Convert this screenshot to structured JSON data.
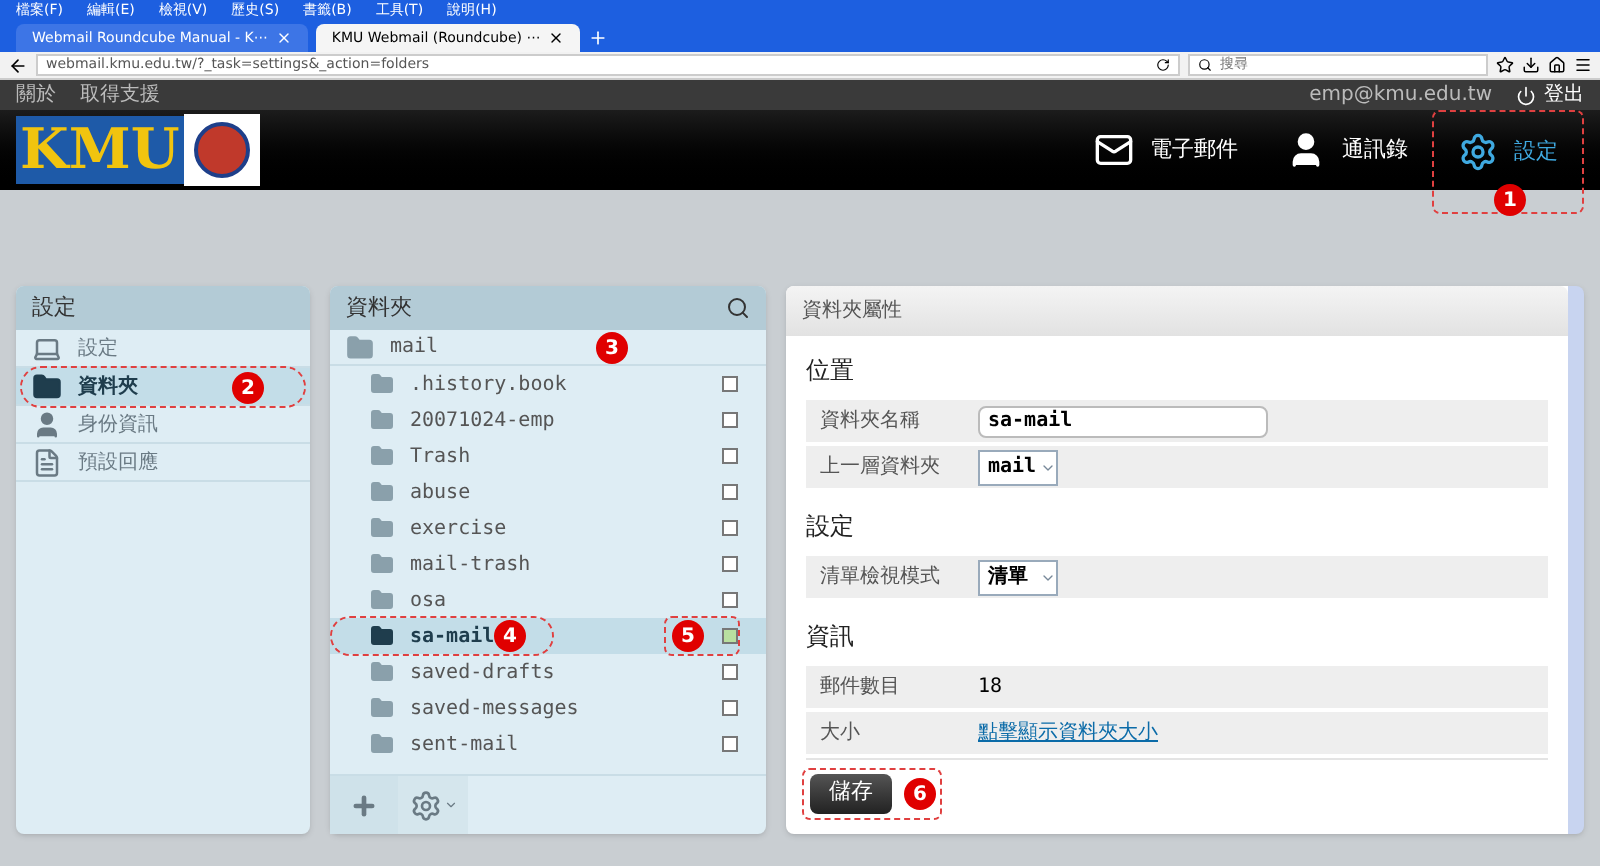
{
  "browser": {
    "menu": [
      "檔案(F)",
      "編輯(E)",
      "檢視(V)",
      "歷史(S)",
      "書籤(B)",
      "工具(T)",
      "說明(H)"
    ],
    "tabs": [
      {
        "label": "Webmail Roundcube Manual - K⋯",
        "selected": false
      },
      {
        "label": "KMU Webmail (Roundcube) ⋯",
        "selected": true
      }
    ],
    "url": "webmail.kmu.edu.tw/?_task=settings&_action=folders",
    "search_placeholder": "搜尋"
  },
  "app": {
    "top_links": [
      "關於",
      "取得支援"
    ],
    "user": "emp@kmu.edu.tw",
    "logout": "登出",
    "logo": "KMU",
    "nav": [
      {
        "kind": "mail",
        "label": "電子郵件",
        "selected": false
      },
      {
        "kind": "contacts",
        "label": "通訊錄",
        "selected": false
      },
      {
        "kind": "settings",
        "label": "設定",
        "selected": true,
        "callout": "1"
      }
    ]
  },
  "settings_panel": {
    "title": "設定",
    "items": [
      {
        "kind": "prefs",
        "label": "設定",
        "selected": false
      },
      {
        "kind": "folders",
        "label": "資料夾",
        "selected": true,
        "callout": "2"
      },
      {
        "kind": "identity",
        "label": "身份資訊",
        "selected": false
      },
      {
        "kind": "responses",
        "label": "預設回應",
        "selected": false
      }
    ]
  },
  "folders_panel": {
    "title": "資料夾",
    "root": {
      "name": "mail",
      "callout": "3",
      "children": [
        {
          "name": ".history.book",
          "subscribed": false,
          "selected": false
        },
        {
          "name": "20071024-emp",
          "subscribed": false,
          "selected": false
        },
        {
          "name": "Trash",
          "subscribed": false,
          "selected": false
        },
        {
          "name": "abuse",
          "subscribed": false,
          "selected": false
        },
        {
          "name": "exercise",
          "subscribed": false,
          "selected": false
        },
        {
          "name": "mail-trash",
          "subscribed": false,
          "selected": false
        },
        {
          "name": "osa",
          "subscribed": false,
          "selected": false
        },
        {
          "name": "sa-mail",
          "subscribed": true,
          "selected": true,
          "callout": "4",
          "checkbox_callout": "5"
        },
        {
          "name": "saved-drafts",
          "subscribed": false,
          "selected": false
        },
        {
          "name": "saved-messages",
          "subscribed": false,
          "selected": false
        },
        {
          "name": "sent-mail",
          "subscribed": false,
          "selected": false
        }
      ]
    }
  },
  "properties": {
    "title": "資料夾屬性",
    "sections": [
      {
        "heading": "位置",
        "rows": [
          {
            "kind": "text",
            "label": "資料夾名稱",
            "value": "sa-mail"
          },
          {
            "kind": "select",
            "label": "上一層資料夾",
            "value": "mail"
          }
        ]
      },
      {
        "heading": "設定",
        "rows": [
          {
            "kind": "select",
            "label": "清單檢視模式",
            "value": "清單"
          }
        ]
      },
      {
        "heading": "資訊",
        "rows": [
          {
            "kind": "static",
            "label": "郵件數目",
            "value": "18"
          },
          {
            "kind": "link",
            "label": "大小",
            "value": "點擊顯示資料夾大小"
          }
        ]
      }
    ],
    "save": {
      "label": "儲存",
      "callout": "6"
    }
  }
}
